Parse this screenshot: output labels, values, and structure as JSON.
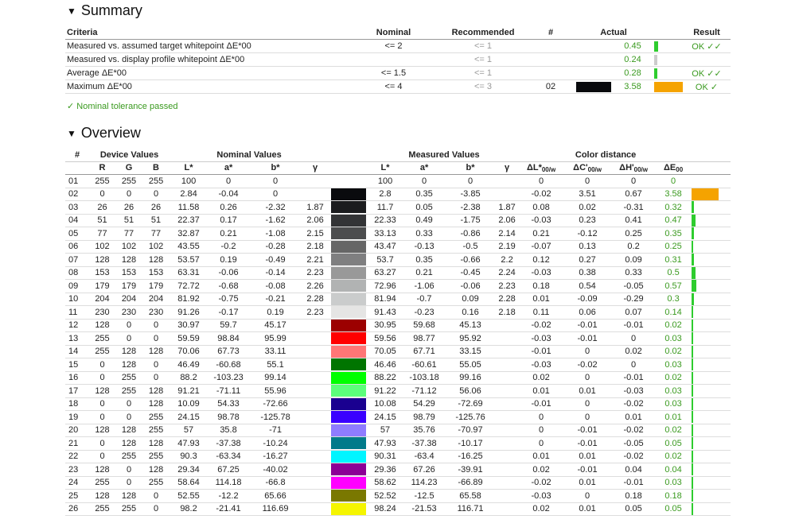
{
  "summary": {
    "title": "Summary",
    "headers": {
      "criteria": "Criteria",
      "nominal": "Nominal",
      "recommended": "Recommended",
      "num": "#",
      "actual": "Actual",
      "result": "Result"
    },
    "rows": [
      {
        "criteria": "Measured vs. assumed target whitepoint ΔE*00",
        "nominal": "<= 2",
        "recommended": "<= 1",
        "num": "",
        "actual": "0.45",
        "result": "OK ✓✓",
        "bar_fraction": 0.14,
        "bar_color": "#2ecc2e",
        "swatch": ""
      },
      {
        "criteria": "Measured vs. display profile whitepoint ΔE*00",
        "nominal": "",
        "recommended": "<= 1",
        "num": "",
        "actual": "0.24",
        "result": "",
        "bar_fraction": 0.08,
        "bar_color": "#cccccc",
        "swatch": ""
      },
      {
        "criteria": "Average ΔE*00",
        "nominal": "<= 1.5",
        "recommended": "<= 1",
        "num": "",
        "actual": "0.28",
        "result": "OK ✓✓",
        "bar_fraction": 0.09,
        "bar_color": "#2ecc2e",
        "swatch": ""
      },
      {
        "criteria": "Maximum ΔE*00",
        "nominal": "<= 4",
        "recommended": "<= 3",
        "num": "02",
        "actual": "3.58",
        "result": "OK ✓",
        "bar_fraction": 1.0,
        "bar_color": "#f5a300",
        "swatch": "#090a0d"
      }
    ],
    "tolerance_note": "✓ Nominal tolerance passed"
  },
  "overview": {
    "title": "Overview",
    "group_headers": {
      "num": "#",
      "device": "Device Values",
      "nominal": "Nominal Values",
      "measured": "Measured Values",
      "distance": "Color distance"
    },
    "columns": {
      "r": "R",
      "g": "G",
      "b": "B",
      "L": "L*",
      "a": "a*",
      "bstar": "b*",
      "gamma": "γ",
      "dL": "ΔL*",
      "dC": "ΔC'",
      "dH": "ΔH'",
      "dE": "ΔE",
      "sub_w": "00/w",
      "sub_00": "00"
    },
    "rows": [
      {
        "n": "01",
        "r": "255",
        "g": "255",
        "b": "255",
        "nL": "100",
        "na": "0",
        "nb": "0",
        "ng": "",
        "sw": "#ffffff",
        "mL": "100",
        "ma": "0",
        "mb": "0",
        "mg": "",
        "dL": "0",
        "dC": "0",
        "dH": "0",
        "dE": "0",
        "dEv": 0
      },
      {
        "n": "02",
        "r": "0",
        "g": "0",
        "b": "0",
        "nL": "2.84",
        "na": "-0.04",
        "nb": "0",
        "ng": "",
        "sw": "#0a0b0e",
        "mL": "2.8",
        "ma": "0.35",
        "mb": "-3.85",
        "mg": "",
        "dL": "-0.02",
        "dC": "3.51",
        "dH": "0.67",
        "dE": "3.58",
        "dEv": 3.58
      },
      {
        "n": "03",
        "r": "26",
        "g": "26",
        "b": "26",
        "nL": "11.58",
        "na": "0.26",
        "nb": "-2.32",
        "ng": "1.87",
        "sw": "#1b1c1e",
        "mL": "11.7",
        "ma": "0.05",
        "mb": "-2.38",
        "mg": "1.87",
        "dL": "0.08",
        "dC": "0.02",
        "dH": "-0.31",
        "dE": "0.32",
        "dEv": 0.32
      },
      {
        "n": "04",
        "r": "51",
        "g": "51",
        "b": "51",
        "nL": "22.37",
        "na": "0.17",
        "nb": "-1.62",
        "ng": "2.06",
        "sw": "#333436",
        "mL": "22.33",
        "ma": "0.49",
        "mb": "-1.75",
        "mg": "2.06",
        "dL": "-0.03",
        "dC": "0.23",
        "dH": "0.41",
        "dE": "0.47",
        "dEv": 0.47
      },
      {
        "n": "05",
        "r": "77",
        "g": "77",
        "b": "77",
        "nL": "32.87",
        "na": "0.21",
        "nb": "-1.08",
        "ng": "2.15",
        "sw": "#4c4d4e",
        "mL": "33.13",
        "ma": "0.33",
        "mb": "-0.86",
        "mg": "2.14",
        "dL": "0.21",
        "dC": "-0.12",
        "dH": "0.25",
        "dE": "0.35",
        "dEv": 0.35
      },
      {
        "n": "06",
        "r": "102",
        "g": "102",
        "b": "102",
        "nL": "43.55",
        "na": "-0.2",
        "nb": "-0.28",
        "ng": "2.18",
        "sw": "#666666",
        "mL": "43.47",
        "ma": "-0.13",
        "mb": "-0.5",
        "mg": "2.19",
        "dL": "-0.07",
        "dC": "0.13",
        "dH": "0.2",
        "dE": "0.25",
        "dEv": 0.25
      },
      {
        "n": "07",
        "r": "128",
        "g": "128",
        "b": "128",
        "nL": "53.57",
        "na": "0.19",
        "nb": "-0.49",
        "ng": "2.21",
        "sw": "#7f7f80",
        "mL": "53.7",
        "ma": "0.35",
        "mb": "-0.66",
        "mg": "2.2",
        "dL": "0.12",
        "dC": "0.27",
        "dH": "0.09",
        "dE": "0.31",
        "dEv": 0.31
      },
      {
        "n": "08",
        "r": "153",
        "g": "153",
        "b": "153",
        "nL": "63.31",
        "na": "-0.06",
        "nb": "-0.14",
        "ng": "2.23",
        "sw": "#999999",
        "mL": "63.27",
        "ma": "0.21",
        "mb": "-0.45",
        "mg": "2.24",
        "dL": "-0.03",
        "dC": "0.38",
        "dH": "0.33",
        "dE": "0.5",
        "dEv": 0.5
      },
      {
        "n": "09",
        "r": "179",
        "g": "179",
        "b": "179",
        "nL": "72.72",
        "na": "-0.68",
        "nb": "-0.08",
        "ng": "2.26",
        "sw": "#b1b3b3",
        "mL": "72.96",
        "ma": "-1.06",
        "mb": "-0.06",
        "mg": "2.23",
        "dL": "0.18",
        "dC": "0.54",
        "dH": "-0.05",
        "dE": "0.57",
        "dEv": 0.57
      },
      {
        "n": "10",
        "r": "204",
        "g": "204",
        "b": "204",
        "nL": "81.92",
        "na": "-0.75",
        "nb": "-0.21",
        "ng": "2.28",
        "sw": "#cacccc",
        "mL": "81.94",
        "ma": "-0.7",
        "mb": "0.09",
        "mg": "2.28",
        "dL": "0.01",
        "dC": "-0.09",
        "dH": "-0.29",
        "dE": "0.3",
        "dEv": 0.3
      },
      {
        "n": "11",
        "r": "230",
        "g": "230",
        "b": "230",
        "nL": "91.26",
        "na": "-0.17",
        "nb": "0.19",
        "ng": "2.23",
        "sw": "#e5e5e4",
        "mL": "91.43",
        "ma": "-0.23",
        "mb": "0.16",
        "mg": "2.18",
        "dL": "0.11",
        "dC": "0.06",
        "dH": "0.07",
        "dE": "0.14",
        "dEv": 0.14
      },
      {
        "n": "12",
        "r": "128",
        "g": "0",
        "b": "0",
        "nL": "30.97",
        "na": "59.7",
        "nb": "45.17",
        "ng": "",
        "sw": "#9c0000",
        "mL": "30.95",
        "ma": "59.68",
        "mb": "45.13",
        "mg": "",
        "dL": "-0.02",
        "dC": "-0.01",
        "dH": "-0.01",
        "dE": "0.02",
        "dEv": 0.02
      },
      {
        "n": "13",
        "r": "255",
        "g": "0",
        "b": "0",
        "nL": "59.59",
        "na": "98.84",
        "nb": "95.99",
        "ng": "",
        "sw": "#ff0000",
        "mL": "59.56",
        "ma": "98.77",
        "mb": "95.92",
        "mg": "",
        "dL": "-0.03",
        "dC": "-0.01",
        "dH": "0",
        "dE": "0.03",
        "dEv": 0.03
      },
      {
        "n": "14",
        "r": "255",
        "g": "128",
        "b": "128",
        "nL": "70.06",
        "na": "67.73",
        "nb": "33.11",
        "ng": "",
        "sw": "#ff7676",
        "mL": "70.05",
        "ma": "67.71",
        "mb": "33.15",
        "mg": "",
        "dL": "-0.01",
        "dC": "0",
        "dH": "0.02",
        "dE": "0.02",
        "dEv": 0.02
      },
      {
        "n": "15",
        "r": "0",
        "g": "128",
        "b": "0",
        "nL": "46.49",
        "na": "-60.68",
        "nb": "55.1",
        "ng": "",
        "sw": "#007500",
        "mL": "46.46",
        "ma": "-60.61",
        "mb": "55.05",
        "mg": "",
        "dL": "-0.03",
        "dC": "-0.02",
        "dH": "0",
        "dE": "0.03",
        "dEv": 0.03
      },
      {
        "n": "16",
        "r": "0",
        "g": "255",
        "b": "0",
        "nL": "88.2",
        "na": "-103.23",
        "nb": "99.14",
        "ng": "",
        "sw": "#00ff00",
        "mL": "88.22",
        "ma": "-103.18",
        "mb": "99.16",
        "mg": "",
        "dL": "0.02",
        "dC": "0",
        "dH": "-0.01",
        "dE": "0.02",
        "dEv": 0.02
      },
      {
        "n": "17",
        "r": "128",
        "g": "255",
        "b": "128",
        "nL": "91.21",
        "na": "-71.11",
        "nb": "55.96",
        "ng": "",
        "sw": "#5cff7a",
        "mL": "91.22",
        "ma": "-71.12",
        "mb": "56.06",
        "mg": "",
        "dL": "0.01",
        "dC": "0.01",
        "dH": "-0.03",
        "dE": "0.03",
        "dEv": 0.03
      },
      {
        "n": "18",
        "r": "0",
        "g": "0",
        "b": "128",
        "nL": "10.09",
        "na": "54.33",
        "nb": "-72.66",
        "ng": "",
        "sw": "#1a0090",
        "mL": "10.08",
        "ma": "54.29",
        "mb": "-72.69",
        "mg": "",
        "dL": "-0.01",
        "dC": "0",
        "dH": "-0.02",
        "dE": "0.03",
        "dEv": 0.03
      },
      {
        "n": "19",
        "r": "0",
        "g": "0",
        "b": "255",
        "nL": "24.15",
        "na": "98.78",
        "nb": "-125.78",
        "ng": "",
        "sw": "#3a00ff",
        "mL": "24.15",
        "ma": "98.79",
        "mb": "-125.76",
        "mg": "",
        "dL": "0",
        "dC": "0",
        "dH": "0.01",
        "dE": "0.01",
        "dEv": 0.01
      },
      {
        "n": "20",
        "r": "128",
        "g": "128",
        "b": "255",
        "nL": "57",
        "na": "35.8",
        "nb": "-71",
        "ng": "",
        "sw": "#8f7cff",
        "mL": "57",
        "ma": "35.76",
        "mb": "-70.97",
        "mg": "",
        "dL": "0",
        "dC": "-0.01",
        "dH": "-0.02",
        "dE": "0.02",
        "dEv": 0.02
      },
      {
        "n": "21",
        "r": "0",
        "g": "128",
        "b": "128",
        "nL": "47.93",
        "na": "-37.38",
        "nb": "-10.24",
        "ng": "",
        "sw": "#007a8a",
        "mL": "47.93",
        "ma": "-37.38",
        "mb": "-10.17",
        "mg": "",
        "dL": "0",
        "dC": "-0.01",
        "dH": "-0.05",
        "dE": "0.05",
        "dEv": 0.05
      },
      {
        "n": "22",
        "r": "0",
        "g": "255",
        "b": "255",
        "nL": "90.3",
        "na": "-63.34",
        "nb": "-16.27",
        "ng": "",
        "sw": "#00f5ff",
        "mL": "90.31",
        "ma": "-63.4",
        "mb": "-16.25",
        "mg": "",
        "dL": "0.01",
        "dC": "0.01",
        "dH": "-0.02",
        "dE": "0.02",
        "dEv": 0.02
      },
      {
        "n": "23",
        "r": "128",
        "g": "0",
        "b": "128",
        "nL": "29.34",
        "na": "67.25",
        "nb": "-40.02",
        "ng": "",
        "sw": "#8c0096",
        "mL": "29.36",
        "ma": "67.26",
        "mb": "-39.91",
        "mg": "",
        "dL": "0.02",
        "dC": "-0.01",
        "dH": "0.04",
        "dE": "0.04",
        "dEv": 0.04
      },
      {
        "n": "24",
        "r": "255",
        "g": "0",
        "b": "255",
        "nL": "58.64",
        "na": "114.18",
        "nb": "-66.8",
        "ng": "",
        "sw": "#ff00ff",
        "mL": "58.62",
        "ma": "114.23",
        "mb": "-66.89",
        "mg": "",
        "dL": "-0.02",
        "dC": "0.01",
        "dH": "-0.01",
        "dE": "0.03",
        "dEv": 0.03
      },
      {
        "n": "25",
        "r": "128",
        "g": "128",
        "b": "0",
        "nL": "52.55",
        "na": "-12.2",
        "nb": "65.66",
        "ng": "",
        "sw": "#7a7800",
        "mL": "52.52",
        "ma": "-12.5",
        "mb": "65.58",
        "mg": "",
        "dL": "-0.03",
        "dC": "0",
        "dH": "0.18",
        "dE": "0.18",
        "dEv": 0.18
      },
      {
        "n": "26",
        "r": "255",
        "g": "255",
        "b": "0",
        "nL": "98.2",
        "na": "-21.41",
        "nb": "116.69",
        "ng": "",
        "sw": "#f5f500",
        "mL": "98.24",
        "ma": "-21.53",
        "mb": "116.71",
        "mg": "",
        "dL": "0.02",
        "dC": "0.01",
        "dH": "0.05",
        "dE": "0.05",
        "dEv": 0.05
      }
    ],
    "colors": {
      "ok_green": "#3a9a1f",
      "bar_green": "#2ecc2e",
      "bar_orange": "#f5a300"
    }
  }
}
